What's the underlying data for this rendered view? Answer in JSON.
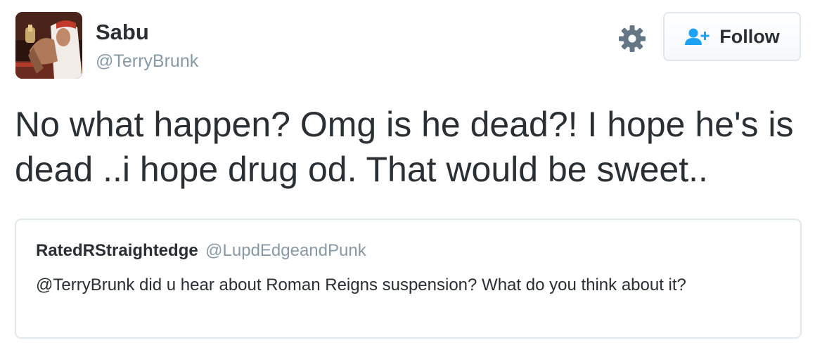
{
  "author": {
    "display_name": "Sabu",
    "handle": "@TerryBrunk",
    "avatar_icon": "profile-photo"
  },
  "actions": {
    "settings_icon": "gear-icon",
    "follow_label": "Follow",
    "follow_icon": "add-user-icon"
  },
  "tweet": {
    "text": "No what happen? Omg is he dead?! I hope he's is dead ..i hope drug od. That would be sweet.."
  },
  "quoted_tweet": {
    "display_name": "RatedRStraightedge",
    "handle": "@LupdEdgeandPunk",
    "text": "@TerryBrunk did u hear about Roman Reigns suspension? What do you think about it?"
  },
  "colors": {
    "text": "#292f33",
    "muted": "#8899a6",
    "accent": "#1da1f2",
    "border": "#e1e8ed"
  }
}
